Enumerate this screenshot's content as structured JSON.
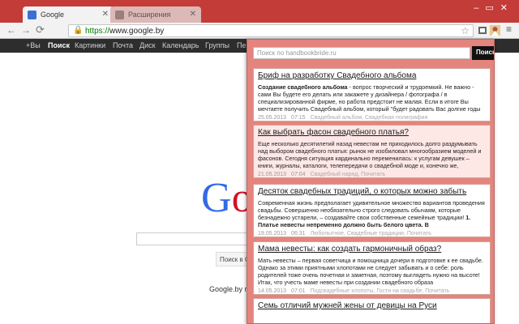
{
  "browser": {
    "tabs": [
      {
        "label": "Google",
        "active": true
      },
      {
        "label": "Расширения",
        "active": false
      }
    ],
    "url_prefix": "https://",
    "url_host": "www.google.by"
  },
  "gbar": {
    "items": [
      "+Вы",
      "Поиск",
      "Картинки",
      "Почта",
      "Диск",
      "Календарь",
      "Группы",
      "Пер"
    ]
  },
  "google": {
    "logo_letters": [
      "G",
      "o",
      "o"
    ],
    "search_button": "Поиск в Google",
    "footer": "Google.by пр"
  },
  "popup": {
    "search_placeholder": "Поиск по handbookbride.ru",
    "search_button": "Поиск",
    "articles": [
      {
        "title": "Бриф на разработку Свадебного альбома",
        "lead": "Создание свадебного альбома",
        "body": " - вопрос творческий и трудоемкий. Не важно - сами Вы будете его делать или закажете у дизайнера / фотографа / в специализированной фирме, но работа предстоит не малая. Если в итоге Вы мечтаете получить Свадебный альбом, который \"будет радовать Вас долгие годы",
        "date": "25.05.2013",
        "time": "07:15",
        "categories": "Свадебный альбом, Свадебная полиграфия"
      },
      {
        "title": "Как выбрать фасон свадебного платья?",
        "lead": "",
        "body": "Еще несколько десятилетий назад невестам не приходилось долго раздумывать над выбором свадебного платья: рынок не изобиловал многообразием моделей и фасонов. Сегодня ситуация кардинально переменилась: к услугам девушек – книги, журналы, каталоги, телепередачи о свадебной моде и, конечно же,",
        "date": "21.05.2013",
        "time": "07:04",
        "categories": "Свадебный наряд, Почитать"
      },
      {
        "title": "Десяток свадебных традиций, о которых можно забыть",
        "lead": "",
        "body": "Современная жизнь предполагает удивительное множество вариантов проведения свадьбы. Совершенно необязательно строго следовать обычаям, которые безнадежно устарели, – создавайте свои собственные семейные традиции!",
        "body_bold": " 1. Платье невесты непременно должно быть белого цвета. В",
        "date": "19.05.2013",
        "time": "06:31",
        "categories": "Любопытное, Свадебные традиции, Почитать"
      },
      {
        "title": "Мама невесты: как создать гармоничный образ?",
        "lead": "",
        "body": "Мать невесты – первая советчица и помощница дочери в подготовке к ее свадьбе. Однако за этими приятными хлопотами не следует забывать и о себе: роль родителей тоже очень почетная и заметная, поэтому выглядеть нужно на высоте! Итак, что учесть маме невесты при создании свадебного образа",
        "date": "14.05.2013",
        "time": "07:01",
        "categories": "Подсвадебные хлопоты, Гости на свадьбе, Почитать"
      },
      {
        "title": "Семь отличий мужней жены от девицы на Руси",
        "lead": "",
        "body": "",
        "date": "",
        "time": "",
        "categories": ""
      }
    ]
  }
}
